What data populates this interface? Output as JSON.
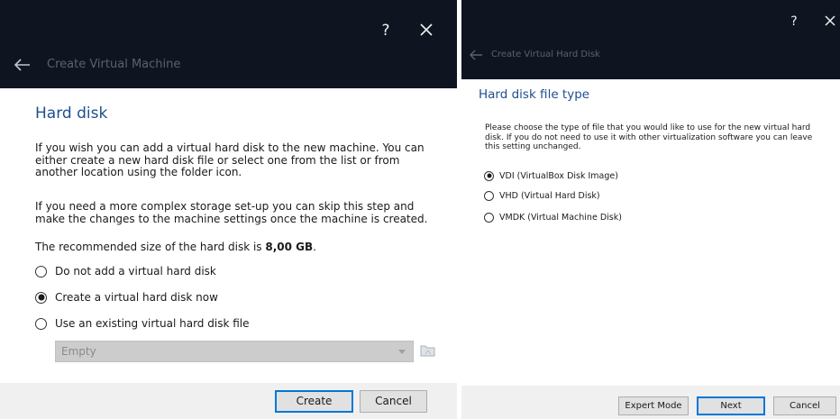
{
  "colors": {
    "titlebar_bg": "#0f1520",
    "heading_blue": "#1e4f8f",
    "footer_bg": "#f0f0f0",
    "default_button_border": "#0078d7"
  },
  "create_vm_dialog": {
    "help_label": "?",
    "title": "Create Virtual Machine",
    "heading": "Hard disk",
    "paragraph_1": "If you wish you can add a virtual hard disk to the new machine. You can either create a new hard disk file or select one from the list or from another location using the folder icon.",
    "paragraph_2": "If you need a more complex storage set-up you can skip this step and make the changes to the machine settings once the machine is created.",
    "recommended_prefix": "The recommended size of the hard disk is ",
    "recommended_size": "8,00 GB",
    "recommended_suffix": ".",
    "options": [
      {
        "label": "Do not add a virtual hard disk",
        "selected": false
      },
      {
        "label": "Create a virtual hard disk now",
        "selected": true
      },
      {
        "label": "Use an existing virtual hard disk file",
        "selected": false
      }
    ],
    "existing_disk_select": {
      "value": "Empty",
      "enabled": false
    },
    "icons": {
      "close": "close-icon",
      "back": "back-arrow-icon",
      "dropdown": "chevron-down-icon",
      "folder": "folder-icon"
    },
    "buttons": {
      "create": "Create",
      "cancel": "Cancel"
    }
  },
  "create_vhd_dialog": {
    "help_label": "?",
    "title": "Create Virtual Hard Disk",
    "heading": "Hard disk file type",
    "description": "Please choose the type of file that you would like to use for the new virtual hard disk. If you do not need to use it with other virtualization software you can leave this setting unchanged.",
    "options": [
      {
        "label": "VDI (VirtualBox Disk Image)",
        "selected": true
      },
      {
        "label": "VHD (Virtual Hard Disk)",
        "selected": false
      },
      {
        "label": "VMDK (Virtual Machine Disk)",
        "selected": false
      }
    ],
    "icons": {
      "close": "close-icon",
      "back": "back-arrow-icon"
    },
    "buttons": {
      "expert_mode": "Expert Mode",
      "next": "Next",
      "cancel": "Cancel"
    }
  }
}
